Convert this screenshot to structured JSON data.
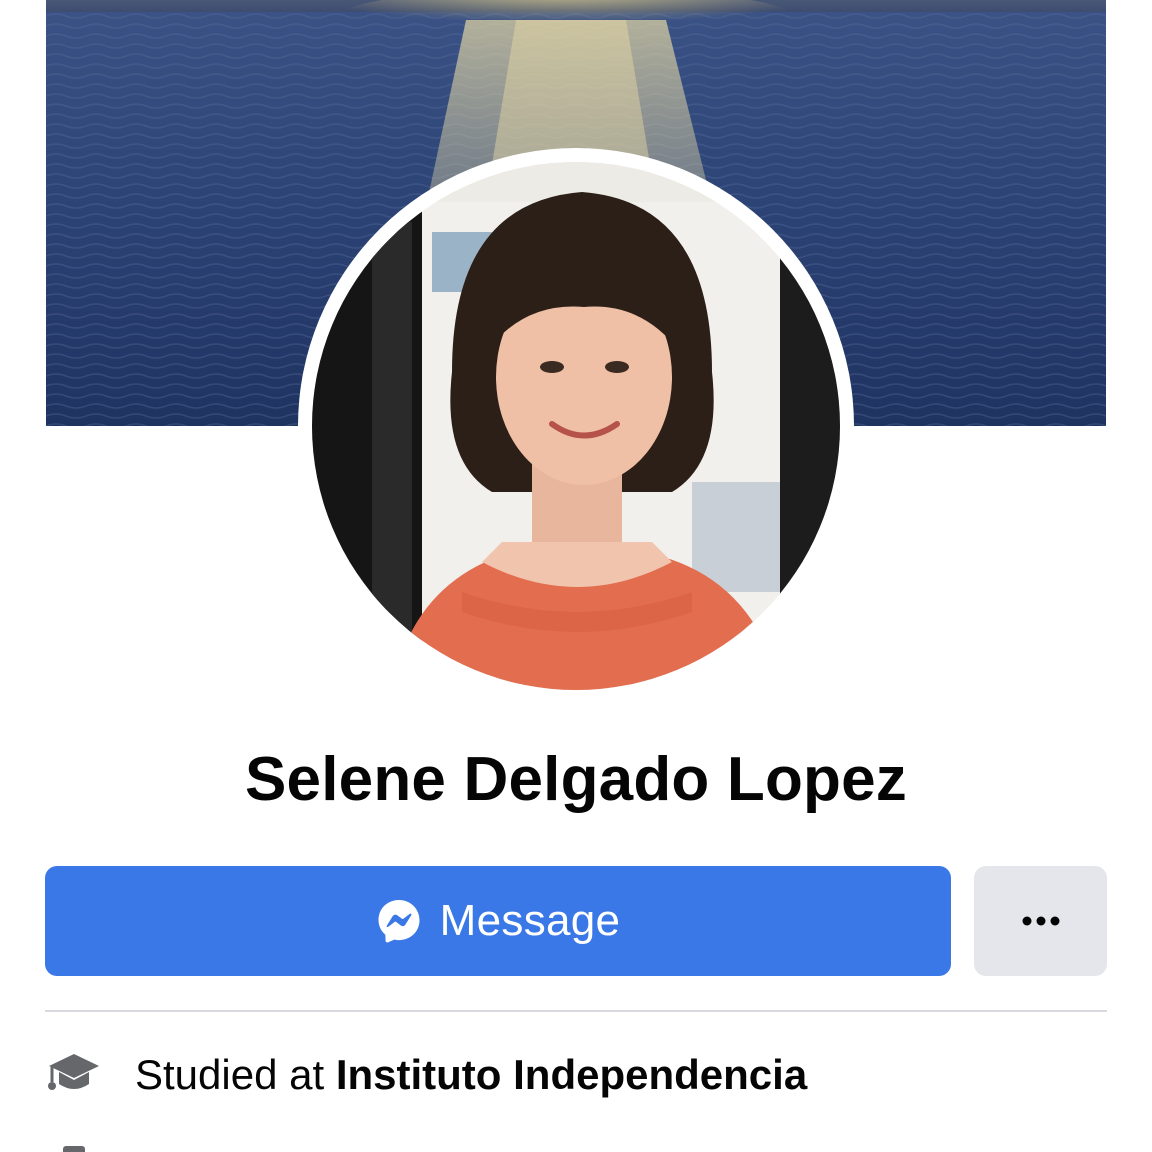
{
  "profile": {
    "name": "Selene Delgado Lopez"
  },
  "actions": {
    "message_label": "Message",
    "more_icon": "ellipsis-icon"
  },
  "about": {
    "education_prefix": "Studied at",
    "education_place": "Instituto Independencia",
    "education_icon": "graduation-cap-icon"
  },
  "colors": {
    "message_button": "#3a78e7",
    "more_button": "#e5e6eb",
    "divider": "#d9dadf",
    "text": "#050505"
  }
}
